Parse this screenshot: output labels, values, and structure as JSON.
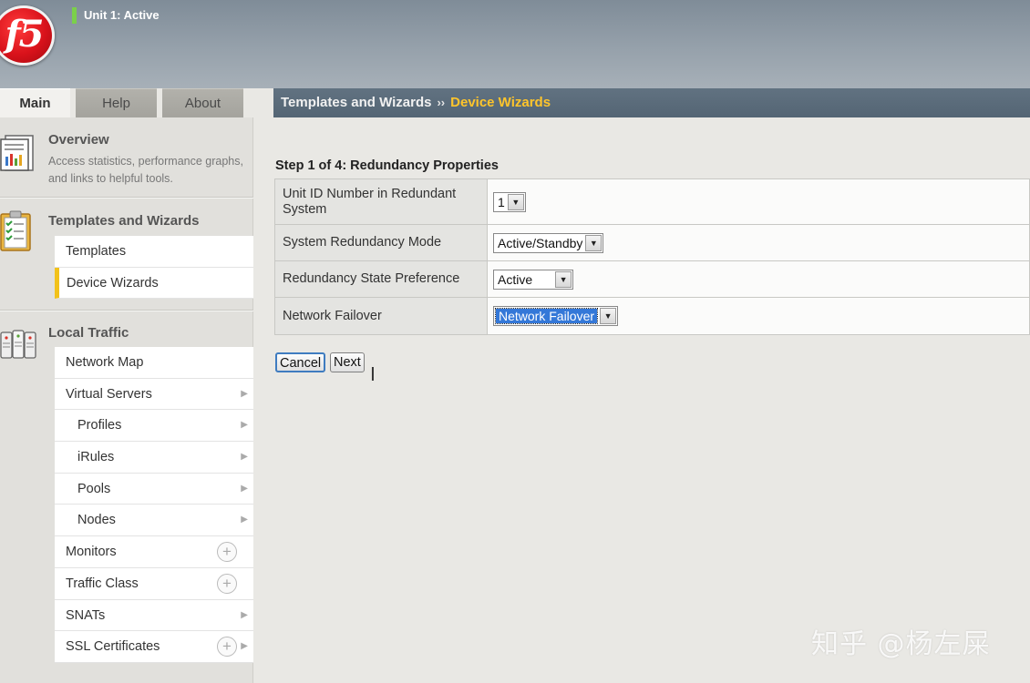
{
  "header": {
    "logo_text": "f5",
    "unit_status": "Unit 1: Active",
    "colors": {
      "status_indicator": "#7bd04a",
      "logo_red": "#d9121b"
    }
  },
  "tabs": [
    {
      "label": "Main",
      "active": true
    },
    {
      "label": "Help",
      "active": false
    },
    {
      "label": "About",
      "active": false
    }
  ],
  "breadcrumb": {
    "parent": "Templates and Wizards",
    "separator": "››",
    "current": "Device Wizards"
  },
  "sidebar": {
    "overview": {
      "title": "Overview",
      "description": "Access statistics, performance graphs, and links to helpful tools.",
      "icon": "overview-report-icon"
    },
    "templates_wizards": {
      "title": "Templates and Wizards",
      "icon": "clipboard-checklist-icon",
      "items": [
        {
          "label": "Templates",
          "selected": false
        },
        {
          "label": "Device Wizards",
          "selected": true
        }
      ]
    },
    "local_traffic": {
      "title": "Local Traffic",
      "icon": "servers-icon",
      "items": [
        {
          "label": "Network Map",
          "sub": false,
          "arrow": false,
          "plus": false
        },
        {
          "label": "Virtual Servers",
          "sub": false,
          "arrow": true,
          "plus": false
        },
        {
          "label": "Profiles",
          "sub": true,
          "arrow": true,
          "plus": false
        },
        {
          "label": "iRules",
          "sub": true,
          "arrow": true,
          "plus": false
        },
        {
          "label": "Pools",
          "sub": true,
          "arrow": true,
          "plus": false
        },
        {
          "label": "Nodes",
          "sub": true,
          "arrow": true,
          "plus": false
        },
        {
          "label": "Monitors",
          "sub": false,
          "arrow": false,
          "plus": true
        },
        {
          "label": "Traffic Class",
          "sub": false,
          "arrow": false,
          "plus": true
        },
        {
          "label": "SNATs",
          "sub": false,
          "arrow": true,
          "plus": false
        },
        {
          "label": "SSL Certificates",
          "sub": false,
          "arrow": true,
          "plus": true
        }
      ]
    }
  },
  "main": {
    "step_title": "Step 1 of 4: Redundancy Properties",
    "fields": [
      {
        "label": "Unit ID Number in Redundant System",
        "value": "1"
      },
      {
        "label": "System Redundancy Mode",
        "value": "Active/Standby"
      },
      {
        "label": "Redundancy State Preference",
        "value": "Active"
      },
      {
        "label": "Network Failover",
        "value": "Network Failover"
      }
    ],
    "buttons": {
      "cancel": "Cancel",
      "next": "Next"
    }
  },
  "watermark": "知乎 @杨左屎"
}
